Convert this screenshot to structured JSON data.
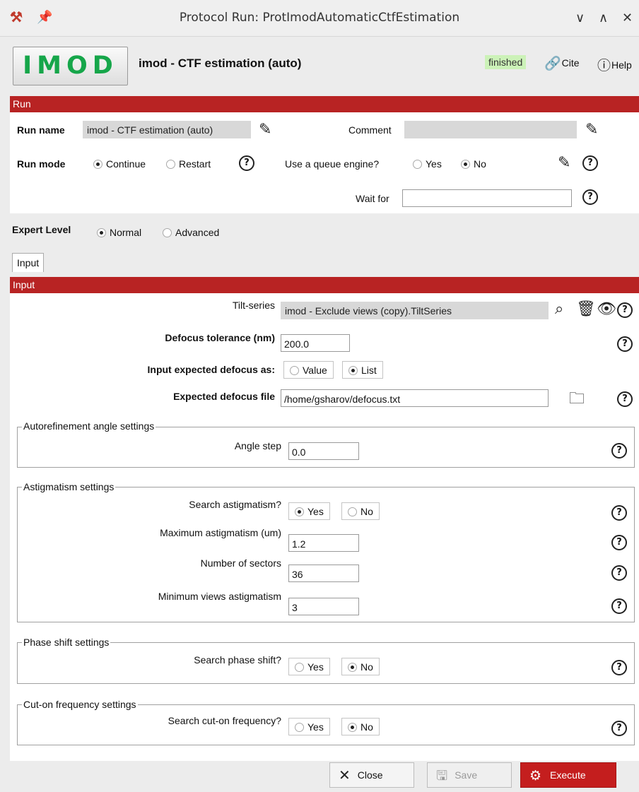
{
  "window": {
    "title": "Protocol Run: ProtImodAutomaticCtfEstimation",
    "controls": [
      "∨",
      "∧",
      "✕"
    ]
  },
  "header": {
    "logo": "IMOD",
    "protocol_title": "imod - CTF estimation (auto)",
    "status": "finished",
    "cite": "Cite",
    "help": "Help"
  },
  "run": {
    "section_label": "Run",
    "run_name_label": "Run name",
    "run_name_value": "imod - CTF estimation (auto)",
    "comment_label": "Comment",
    "comment_value": "",
    "run_mode_label": "Run mode",
    "continue": "Continue",
    "restart": "Restart",
    "run_mode_selected": "Continue",
    "queue_label": "Use a queue engine?",
    "yes": "Yes",
    "no": "No",
    "queue_selected": "No",
    "wait_for_label": "Wait for",
    "wait_for_value": ""
  },
  "expert": {
    "label": "Expert Level",
    "normal": "Normal",
    "advanced": "Advanced",
    "selected": "Normal"
  },
  "tab": {
    "label": "Input"
  },
  "input": {
    "section_label": "Input",
    "tilt_label": "Tilt-series",
    "tilt_value": "imod - Exclude views (copy).TiltSeries",
    "defocus_tol_label": "Defocus tolerance (nm)",
    "defocus_tol_value": "200.0",
    "expected_as_label": "Input expected defocus as:",
    "value": "Value",
    "list": "List",
    "expected_as_selected": "List",
    "defocus_file_label": "Expected defocus file",
    "defocus_file_value": "/home/gsharov/defocus.txt"
  },
  "autorefine": {
    "title": "Autorefinement angle settings",
    "angle_step_label": "Angle step",
    "angle_step_value": "0.0"
  },
  "astig": {
    "title": "Astigmatism settings",
    "search_label": "Search astigmatism?",
    "yes": "Yes",
    "no": "No",
    "search_selected": "Yes",
    "max_label": "Maximum astigmatism (um)",
    "max_value": "1.2",
    "sectors_label": "Number of sectors",
    "sectors_value": "36",
    "minviews_label": "Minimum views astigmatism",
    "minviews_value": "3"
  },
  "phase": {
    "title": "Phase shift settings",
    "search_label": "Search phase shift?",
    "yes": "Yes",
    "no": "No",
    "selected": "No"
  },
  "cuton": {
    "title": "Cut-on frequency settings",
    "search_label": "Search cut-on frequency?",
    "yes": "Yes",
    "no": "No",
    "selected": "No"
  },
  "buttons": {
    "close": "Close",
    "save": "Save",
    "execute": "Execute"
  },
  "colors": {
    "section_red": "#b82323",
    "execute_red": "#c41e1e",
    "status_green": "#ccf2b8",
    "logo_green": "#16a64a"
  },
  "icons": [
    "scipion-logo-icon",
    "pin-icon",
    "pencil-icon",
    "help-icon",
    "search-icon",
    "trash-icon",
    "eye-icon",
    "folder-icon",
    "close-icon",
    "save-icon",
    "gear-icon"
  ]
}
